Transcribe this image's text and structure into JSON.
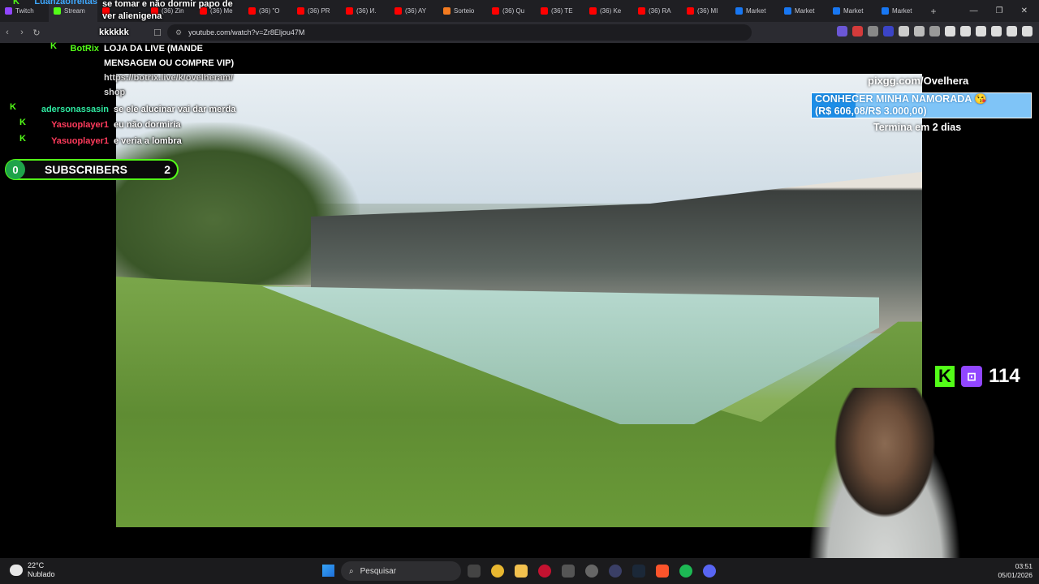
{
  "browser": {
    "tabs": [
      {
        "label": "Twitch",
        "color": "#9146ff"
      },
      {
        "label": "Stream",
        "color": "#53fc18"
      },
      {
        "label": "",
        "color": "#ff0000"
      },
      {
        "label": "(36) Zin",
        "color": "#ff0000"
      },
      {
        "label": "(36) Me",
        "color": "#ff0000"
      },
      {
        "label": "(36) \"O",
        "color": "#ff0000"
      },
      {
        "label": "(36) PR",
        "color": "#ff0000"
      },
      {
        "label": "(36) И.",
        "color": "#ff0000"
      },
      {
        "label": "(36) AY",
        "color": "#ff0000"
      },
      {
        "label": "Sorteio",
        "color": "#f47b20"
      },
      {
        "label": "(36) Qu",
        "color": "#ff0000"
      },
      {
        "label": "(36) TE",
        "color": "#ff0000"
      },
      {
        "label": "(36) Ke",
        "color": "#ff0000"
      },
      {
        "label": "(36) RA",
        "color": "#ff0000"
      },
      {
        "label": "(36) MI",
        "color": "#ff0000"
      },
      {
        "label": "Market",
        "color": "#1877f2"
      },
      {
        "label": "Market",
        "color": "#1877f2"
      },
      {
        "label": "Market",
        "color": "#1877f2"
      },
      {
        "label": "Market",
        "color": "#1877f2"
      }
    ],
    "url": "youtube.com/watch?v=Zr8Eljou47M"
  },
  "chat": [
    {
      "user": "Luanzaofreitas",
      "color": "#3ea8ff",
      "text": "se tomar e não dormir papo de",
      "text2": "ver alienigena"
    },
    {
      "user": "",
      "color": "#53fc18",
      "text": "kkkkkk",
      "text2": ""
    },
    {
      "user": "BotRix",
      "color": "#53fc18",
      "text": "LOJA DA LIVE (MANDE",
      "text2": "MENSAGEM OU COMPRE VIP)"
    },
    {
      "user": "",
      "color": "#ffffff",
      "text": "https://botrix.live/k/ovelheram/",
      "text2": "shop"
    },
    {
      "user": "adersonassasin",
      "color": "#2ee8a0",
      "text": "se ele alucinar vai dar merda",
      "text2": ""
    },
    {
      "user": "Yasuoplayer1",
      "color": "#ff3b5c",
      "text": "eu não dormiria",
      "text2": ""
    },
    {
      "user": "Yasuoplayer1",
      "color": "#ff3b5c",
      "text": "e veria a lombra",
      "text2": ""
    }
  ],
  "subscribers": {
    "left": "0",
    "label": "SUBSCRIBERS",
    "right": "2"
  },
  "overlay": {
    "pix_url": "pixgg.com/Ovelhera",
    "goal_title": "CONHECER MINHA NAMORADA 😘",
    "goal_amount": "(R$ 606,08/R$ 3.000,00)",
    "goal_progress": 0.2,
    "goal_ends": "Termina em 2 dias",
    "viewers": "114"
  },
  "taskbar": {
    "temperature": "22°C",
    "weather": "Nublado",
    "search_placeholder": "Pesquisar",
    "time": "03:51",
    "date": "05/01/2026"
  }
}
